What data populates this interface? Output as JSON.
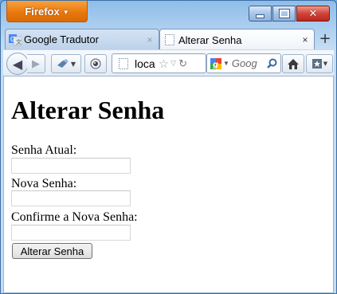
{
  "browser": {
    "menu_button": "Firefox",
    "tabs": [
      {
        "label": "Google Tradutor",
        "close": "×"
      },
      {
        "label": "Alterar Senha",
        "close": "×"
      }
    ],
    "new_tab": "+",
    "address": "loca",
    "search_placeholder": "Goog"
  },
  "page": {
    "title": "Alterar Senha",
    "fields": [
      {
        "label": "Senha Atual:",
        "value": ""
      },
      {
        "label": "Nova Senha:",
        "value": ""
      },
      {
        "label": "Confirme a Nova Senha:",
        "value": ""
      }
    ],
    "submit_label": "Alterar Senha"
  },
  "colors": {
    "firefox_orange": "#e8760b",
    "close_red": "#d1443a",
    "chrome_blue": "#a9cdef"
  }
}
